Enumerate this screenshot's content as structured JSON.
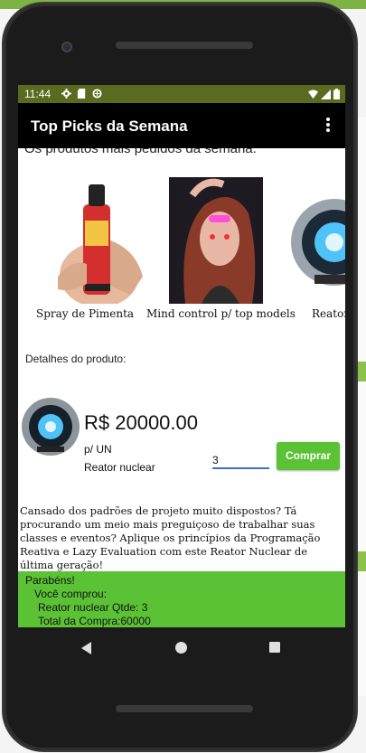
{
  "status_bar": {
    "time": "11:44",
    "left_icons": [
      "gear-icon",
      "sd-card-icon",
      "data-saver-icon"
    ],
    "right_icons": [
      "wifi-icon",
      "signal-icon",
      "battery-icon"
    ],
    "background": "#5a6b1f"
  },
  "app_bar": {
    "title": "Top Picks da Semana",
    "menu_icon": "more-vert-icon"
  },
  "content": {
    "headline": "Os produtos mais pedidos da semana:",
    "carousel": [
      {
        "caption": "Spray de Pimenta",
        "icon": "pepper-spray-image"
      },
      {
        "caption": "Mind control p/ top models",
        "icon": "mind-control-image"
      },
      {
        "caption": "Reator",
        "icon": "arc-reactor-image"
      }
    ],
    "details_label": "Detalhes do produto:",
    "product": {
      "price": "R$ 20000.00",
      "unit": "p/ UN",
      "name": "Reator nuclear",
      "quantity": "3",
      "buy_label": "Comprar",
      "description": "Cansado dos padrões de projeto muito dispostos? Tá procurando um meio mais preguiçoso de trabalhar suas classes e eventos? Aplique os princípios da Programação Reativa e Lazy Evaluation com este Reator Nuclear de última geração!"
    },
    "purchase_result": {
      "line1": "Parabéns!",
      "line2": "Você comprou:",
      "line3": "Reator nuclear Qtde: 3",
      "line4": "Total da Compra:60000",
      "background": "#5bc236"
    }
  },
  "nav_bar": {
    "back_icon": "back-icon",
    "home_icon": "home-icon",
    "recents_icon": "recents-icon"
  },
  "colors": {
    "accent_green": "#5bc236",
    "app_bar": "#000000",
    "input_underline": "#3f6fd0"
  }
}
